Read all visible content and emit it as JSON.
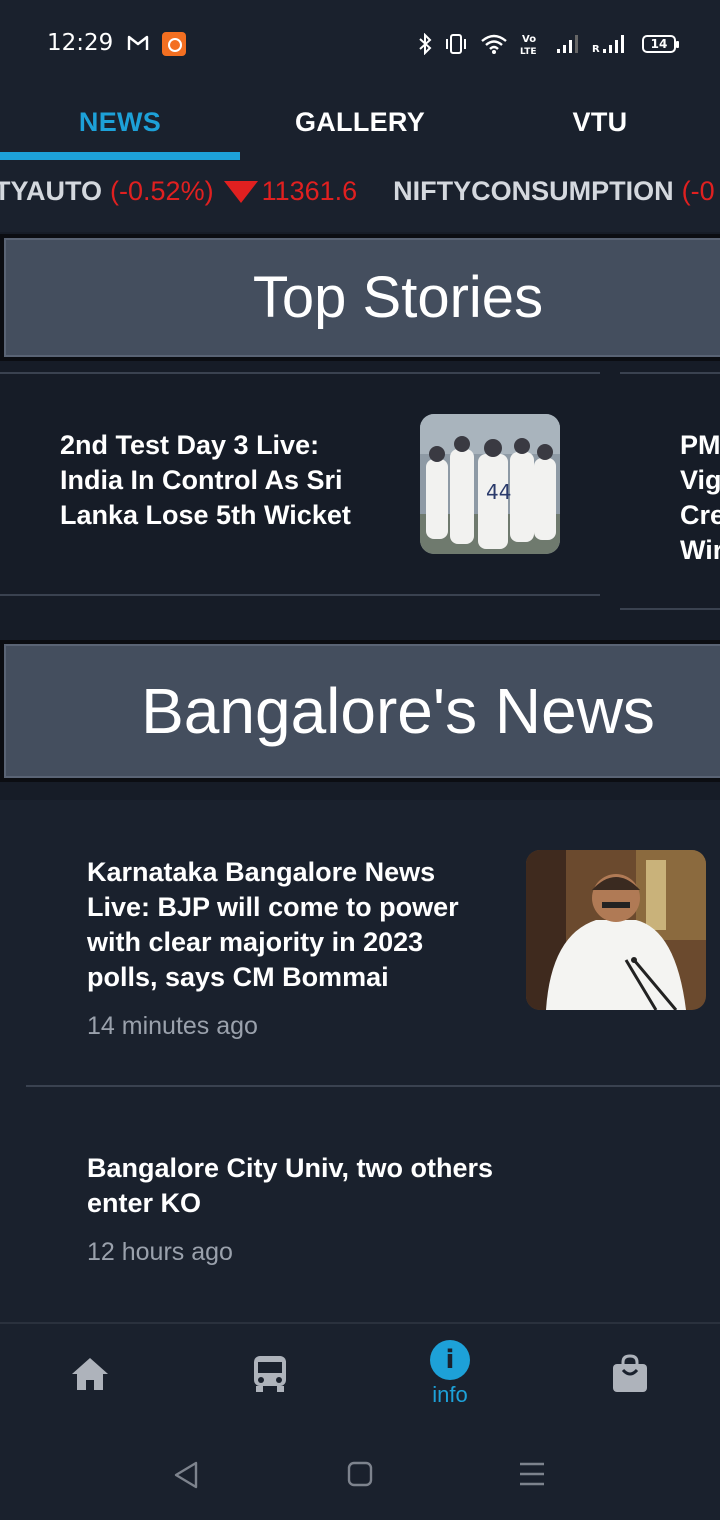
{
  "status_bar": {
    "time": "12:29",
    "battery": "14",
    "icons": [
      "gmail-icon",
      "app-notification-icon",
      "bluetooth-icon",
      "vibrate-icon",
      "wifi-icon",
      "volte-icon",
      "signal-icon",
      "signal-roaming-icon",
      "battery-icon"
    ]
  },
  "tabs": [
    {
      "label": "NEWS",
      "active": true
    },
    {
      "label": "GALLERY",
      "active": false
    },
    {
      "label": "VTU",
      "active": false
    }
  ],
  "ticker": [
    {
      "name": "NIFTYAUTO",
      "change": "(-0.52%)",
      "value": "11361.6"
    },
    {
      "name": "NIFTYCONSUMPTION",
      "change": "(-0",
      "value": ""
    }
  ],
  "ticker_display_first": "TYAUTO",
  "sections": {
    "top_stories": "Top Stories",
    "city_news": "Bangalore's News"
  },
  "top_stories": [
    {
      "title": "2nd Test Day 3 Live: India In Control As Sri Lanka Lose 5th Wicket"
    },
    {
      "title": "PM\nVig\nCre\nWir"
    }
  ],
  "city_news": [
    {
      "title": "Karnataka Bangalore News Live: BJP will come to power with clear majority in 2023 polls, says CM Bommai",
      "time": "14 minutes ago"
    },
    {
      "title": "Bangalore City Univ, two others enter KO",
      "time": "12 hours ago"
    }
  ],
  "bottom_nav": [
    {
      "icon": "home-icon",
      "label": ""
    },
    {
      "icon": "bus-icon",
      "label": ""
    },
    {
      "icon": "info-icon",
      "label": "info",
      "active": true
    },
    {
      "icon": "shopping-bag-icon",
      "label": ""
    }
  ],
  "colors": {
    "accent": "#1da1d8",
    "background": "#161c27",
    "negative": "#e02020"
  }
}
